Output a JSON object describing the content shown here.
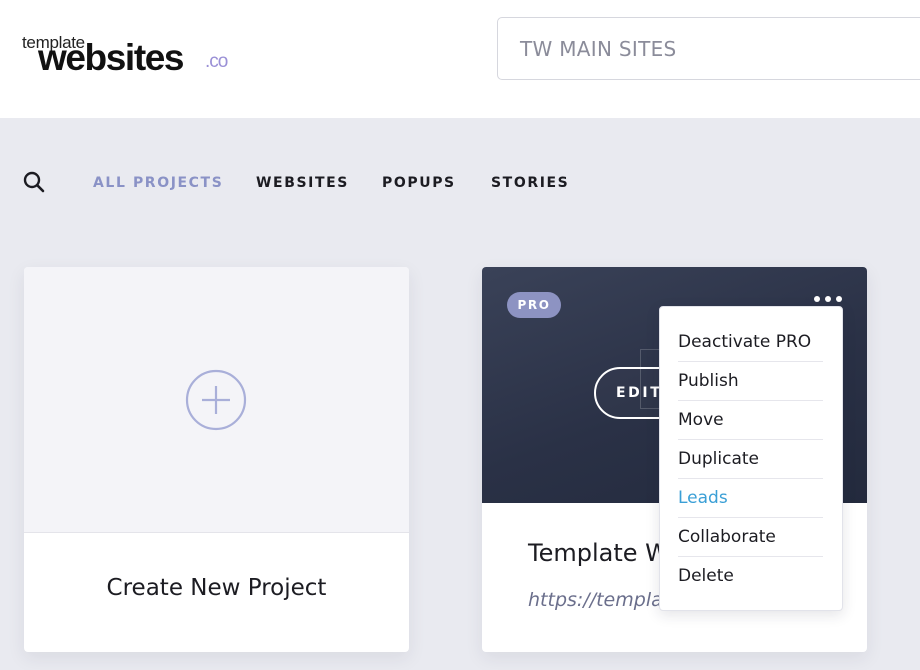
{
  "logo": {
    "small": "template",
    "big": "websites",
    "suffix": ".co"
  },
  "workspace": {
    "value": "TW MAIN SITES"
  },
  "search": {
    "icon": "search-icon"
  },
  "tabs": [
    {
      "label": "ALL PROJECTS",
      "active": true
    },
    {
      "label": "WEBSITES",
      "active": false
    },
    {
      "label": "POPUPS",
      "active": false
    },
    {
      "label": "STORIES",
      "active": false
    }
  ],
  "new_project": {
    "label": "Create New Project",
    "icon": "plus-circle-icon"
  },
  "project": {
    "badge": "PRO",
    "edit_label": "EDIT",
    "title": "Template W",
    "url": "https://templa",
    "more_icon": "more-dots-icon"
  },
  "context_menu": {
    "items": [
      "Deactivate PRO",
      "Publish",
      "Move",
      "Duplicate",
      "Leads",
      "Collaborate",
      "Delete"
    ]
  },
  "colors": {
    "accent": "#8a92c6",
    "badge": "#8d93c2",
    "link": "#3a9fd6",
    "preview_dark": "#2a3146",
    "background": "#e9eaf0"
  }
}
